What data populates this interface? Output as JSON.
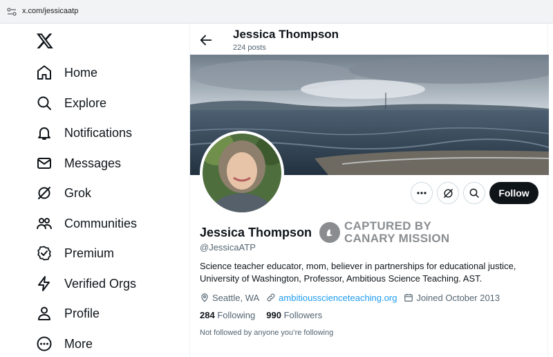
{
  "browser": {
    "url": "x.com/jessicaatp"
  },
  "sidebar": {
    "items": [
      {
        "label": "Home",
        "icon": "home-icon"
      },
      {
        "label": "Explore",
        "icon": "search-icon"
      },
      {
        "label": "Notifications",
        "icon": "bell-icon"
      },
      {
        "label": "Messages",
        "icon": "envelope-icon"
      },
      {
        "label": "Grok",
        "icon": "grok-icon"
      },
      {
        "label": "Communities",
        "icon": "communities-icon"
      },
      {
        "label": "Premium",
        "icon": "premium-badge-icon"
      },
      {
        "label": "Verified Orgs",
        "icon": "lightning-icon"
      },
      {
        "label": "Profile",
        "icon": "person-icon"
      },
      {
        "label": "More",
        "icon": "more-circle-icon"
      }
    ]
  },
  "header": {
    "name": "Jessica Thompson",
    "posts": "224 posts"
  },
  "profile": {
    "name": "Jessica Thompson",
    "handle": "@JessicaATP",
    "bio": "Science teacher educator, mom, believer in partnerships for educational justice, University of Washington, Professor, Ambitious Science Teaching. AST.",
    "location": "Seattle, WA",
    "website": "ambitiousscienceteaching.org",
    "joined": "Joined October 2013",
    "following_count": "284",
    "following_label": "Following",
    "followers_count": "990",
    "followers_label": "Followers",
    "not_followed": "Not followed by anyone you’re following",
    "follow_button": "Follow"
  },
  "watermark": {
    "line1": "CAPTURED BY",
    "line2": "CANARY MISSION"
  },
  "colors": {
    "link": "#1d9bf0",
    "follow_bg": "#0f1419",
    "muted": "#536471"
  }
}
